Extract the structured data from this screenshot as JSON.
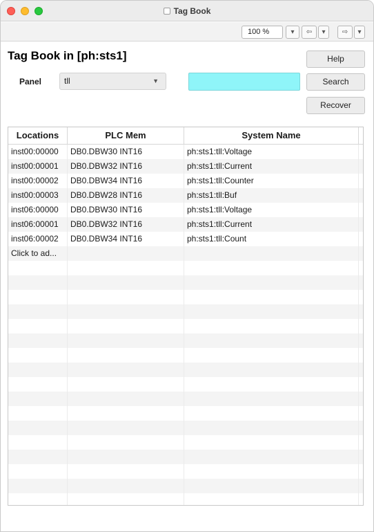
{
  "window": {
    "title": "Tag Book"
  },
  "toolbar": {
    "zoom": "100 %"
  },
  "page": {
    "title": "Tag Book in [ph:sts1]"
  },
  "panel": {
    "label": "Panel",
    "selected": "tll"
  },
  "search": {
    "value": ""
  },
  "buttons": {
    "help": "Help",
    "search": "Search",
    "recover": "Recover"
  },
  "table": {
    "columns": [
      "Locations",
      "PLC Mem",
      "System Name"
    ],
    "rows": [
      [
        "inst00:00000",
        "DB0.DBW30 INT16",
        "ph:sts1:tll:Voltage"
      ],
      [
        "inst00:00001",
        "DB0.DBW32 INT16",
        "ph:sts1:tll:Current"
      ],
      [
        "inst00:00002",
        "DB0.DBW34 INT16",
        "ph:sts1:tll:Counter"
      ],
      [
        "inst00:00003",
        "DB0.DBW28 INT16",
        "ph:sts1:tll:Buf"
      ],
      [
        "inst06:00000",
        "DB0.DBW30 INT16",
        "ph:sts1:tll:Voltage"
      ],
      [
        "inst06:00001",
        "DB0.DBW32 INT16",
        "ph:sts1:tll:Current"
      ],
      [
        "inst06:00002",
        "DB0.DBW34 INT16",
        "ph:sts1:tll:Count"
      ],
      [
        "Click to ad...",
        "",
        ""
      ]
    ]
  }
}
